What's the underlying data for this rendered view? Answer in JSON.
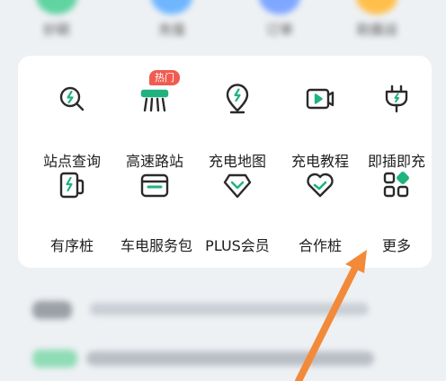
{
  "top_row": {
    "items": [
      {
        "label": "妙砺",
        "color": "#5fd3a0"
      },
      {
        "label": "充值",
        "color": "#6fb6ff"
      },
      {
        "label": "订单",
        "color": "#7fa7ff"
      },
      {
        "label": "助援战",
        "color": "#ffbf4a"
      }
    ]
  },
  "menu": {
    "items": [
      {
        "label": "站点查询",
        "icon": "search-bolt-icon"
      },
      {
        "label": "高速路站",
        "icon": "highway-station-icon",
        "badge": "热门"
      },
      {
        "label": "充电地图",
        "icon": "map-pin-bolt-icon"
      },
      {
        "label": "充电教程",
        "icon": "video-play-icon"
      },
      {
        "label": "即插即充",
        "icon": "plug-bolt-icon"
      },
      {
        "label": "有序桩",
        "icon": "charging-pile-icon"
      },
      {
        "label": "车电服务包",
        "icon": "service-package-icon"
      },
      {
        "label": "PLUS会员",
        "icon": "diamond-icon"
      },
      {
        "label": "合作桩",
        "icon": "handshake-heart-icon"
      },
      {
        "label": "更多",
        "icon": "more-grid-icon"
      }
    ]
  },
  "colors": {
    "accent": "#1fb37d",
    "icon_stroke": "#2a2a2a",
    "badge": "#f15b50",
    "arrow": "#f28a3a"
  }
}
